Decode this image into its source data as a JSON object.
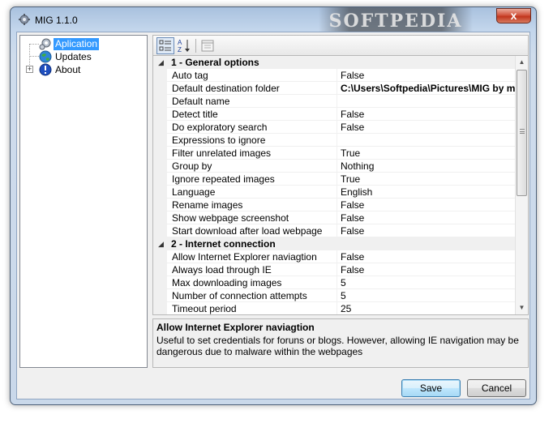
{
  "window": {
    "title": "MIG 1.1.0",
    "watermark": "SOFTPEDIA",
    "close_glyph": "x"
  },
  "tree": {
    "items": [
      {
        "label": "Aplication",
        "icon": "gear-icon",
        "selected": true,
        "has_expander": false
      },
      {
        "label": "Updates",
        "icon": "globe-icon",
        "selected": false,
        "has_expander": false
      },
      {
        "label": "About",
        "icon": "info-icon",
        "selected": false,
        "has_expander": true
      }
    ]
  },
  "toolbar": {
    "buttons": [
      {
        "icon": "categorized-icon",
        "active": true
      },
      {
        "icon": "alphabetical-sort-icon",
        "active": false
      },
      {
        "icon": "property-pages-icon",
        "active": false
      }
    ]
  },
  "grid": {
    "categories": [
      {
        "label": "1 - General options",
        "toggle": "◢",
        "rows": [
          {
            "name": "Auto tag",
            "value": "False"
          },
          {
            "name": "Default destination folder",
            "value": "C:\\Users\\Softpedia\\Pictures\\MIG by mi",
            "bold": true
          },
          {
            "name": "Default name",
            "value": ""
          },
          {
            "name": "Detect title",
            "value": "False"
          },
          {
            "name": "Do exploratory search",
            "value": "False"
          },
          {
            "name": "Expressions to ignore",
            "value": ""
          },
          {
            "name": "Filter unrelated images",
            "value": "True"
          },
          {
            "name": "Group by",
            "value": "Nothing"
          },
          {
            "name": "Ignore repeated images",
            "value": "True"
          },
          {
            "name": "Language",
            "value": "English"
          },
          {
            "name": "Rename images",
            "value": "False"
          },
          {
            "name": "Show webpage screenshot",
            "value": "False"
          },
          {
            "name": "Start download after load webpage",
            "value": "False"
          }
        ]
      },
      {
        "label": "2 - Internet connection",
        "toggle": "◢",
        "rows": [
          {
            "name": "Allow Internet Explorer naviagtion",
            "value": "False"
          },
          {
            "name": "Always load through IE",
            "value": "False"
          },
          {
            "name": "Max downloading images",
            "value": "5"
          },
          {
            "name": "Number of connection attempts",
            "value": "5"
          },
          {
            "name": "Timeout period",
            "value": "25"
          }
        ]
      }
    ],
    "scroll": {
      "up_glyph": "▲",
      "down_glyph": "▼"
    }
  },
  "description": {
    "title": "Allow Internet Explorer naviagtion",
    "text": "Useful to set credentials for foruns or blogs. However, allowing IE navigation may be dangerous due to malware within the webpages"
  },
  "buttons": {
    "save_label": "Save",
    "cancel_label": "Cancel"
  },
  "colors": {
    "selection": "#3399ff",
    "frame": "#a9c1de",
    "close": "#c1351d"
  }
}
